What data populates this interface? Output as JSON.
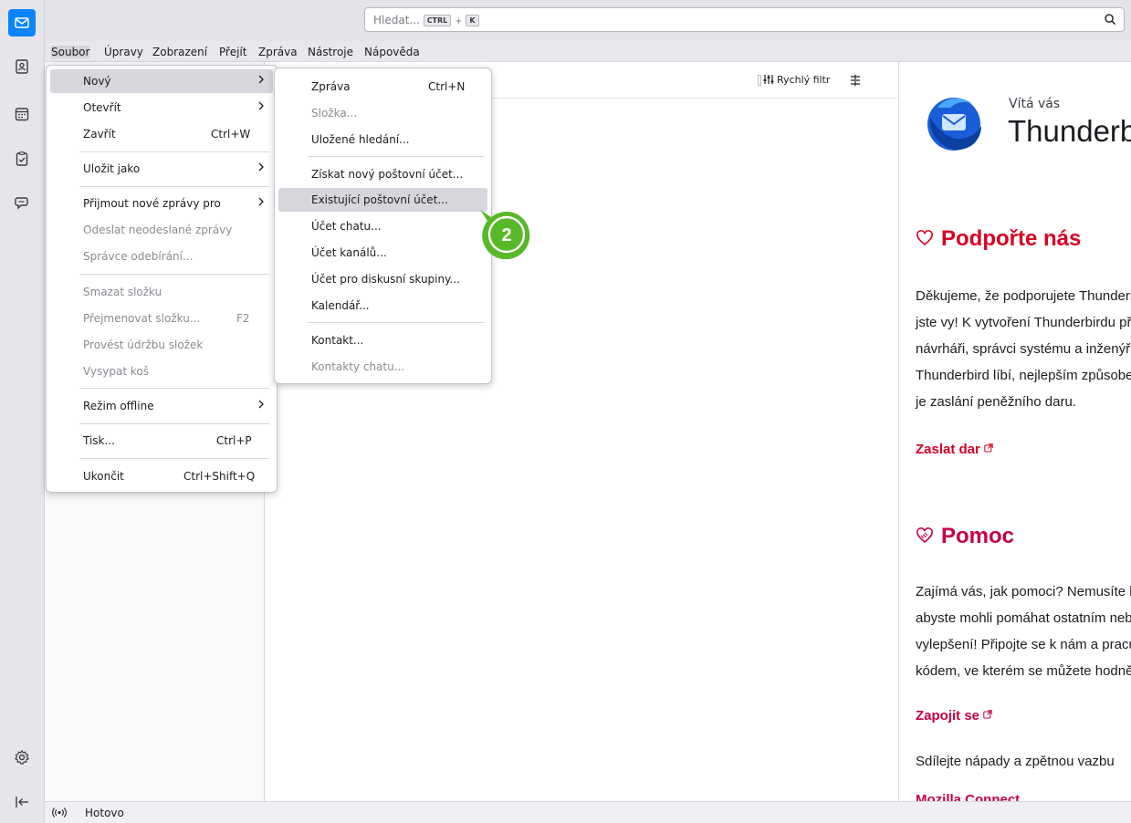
{
  "spaces": {
    "items": [
      {
        "name": "mail-icon"
      },
      {
        "name": "address-book-icon"
      },
      {
        "name": "calendar-icon"
      },
      {
        "name": "tasks-icon"
      },
      {
        "name": "chat-icon"
      }
    ],
    "bottom": [
      {
        "name": "settings-icon"
      },
      {
        "name": "collapse-icon"
      }
    ],
    "accent": "#0a84ff"
  },
  "search": {
    "placeholder": "Hledat...",
    "key1": "CTRL",
    "plus": "+",
    "key2": "K"
  },
  "menubar": {
    "items": [
      "Soubor",
      "Úpravy",
      "Zobrazení",
      "Přejít",
      "Zpráva",
      "Nástroje",
      "Nápověda"
    ]
  },
  "file_menu": {
    "new": "Nový",
    "open": "Otevřít",
    "close": "Zavřít",
    "close_acc": "Ctrl+W",
    "save_as": "Uložit jako",
    "get_messages": "Přijmout nové zprávy pro",
    "send_unsent": "Odeslat neodeslané zprávy",
    "subscriptions": "Správce odebírání...",
    "delete_folder": "Smazat složku",
    "rename_folder": "Přejmenovat složku...",
    "rename_acc": "F2",
    "compact": "Provést údržbu složek",
    "empty_trash": "Vysypat koš",
    "offline": "Režim offline",
    "print": "Tisk...",
    "print_acc": "Ctrl+P",
    "quit": "Ukončit",
    "quit_acc": "Ctrl+Shift+Q"
  },
  "new_submenu": {
    "message": "Zpráva",
    "message_acc": "Ctrl+N",
    "folder": "Složka...",
    "saved_search": "Uložené hledání...",
    "get_account": "Získat nový poštovní účet...",
    "existing_account": "Existující poštovní účet...",
    "chat_account": "Účet chatu...",
    "feed_account": "Účet kanálů...",
    "newsgroup_account": "Účet pro diskusní skupiny...",
    "calendar": "Kalendář...",
    "contact": "Kontakt...",
    "chat_contacts": "Kontakty chatu..."
  },
  "step_badge": {
    "label": "2",
    "color": "#57b927"
  },
  "thread_toolbar": {
    "quick_filter": "Rychlý filtr"
  },
  "start_page": {
    "welcome": "Vítá vás",
    "brand": "Thunderbird",
    "support_title": "Podpořte nás",
    "support_lines": [
      "Děkujeme, že podporujete Thunderbird, protože",
      "jste vy! K vytvoření Thunderbirdu přispívají",
      "návrháři, správci systému a inženýři. Pokud se vám",
      "Thunderbird líbí, nejlepším způsobem, jak pomoci,",
      "je zaslání peněžního daru."
    ],
    "donate": "Zaslat dar",
    "help_title": "Pomoc",
    "help_lines": [
      "Zajímá vás, jak pomoci? Nemusíte být programátor,",
      "abyste mohli pomáhat ostatním nebo navrhovat",
      "vylepšení! Připojte se k nám a pracujte s naším",
      "kódem, ve kterém se můžete hodně naučit."
    ],
    "get_involved": "Zapojit se",
    "share_line": "Sdílejte nápady a zpětnou vazbu",
    "connect": "Mozilla Connect",
    "support_color": "#d70022",
    "help_color": "#c50042"
  },
  "status": {
    "text": "Hotovo"
  }
}
